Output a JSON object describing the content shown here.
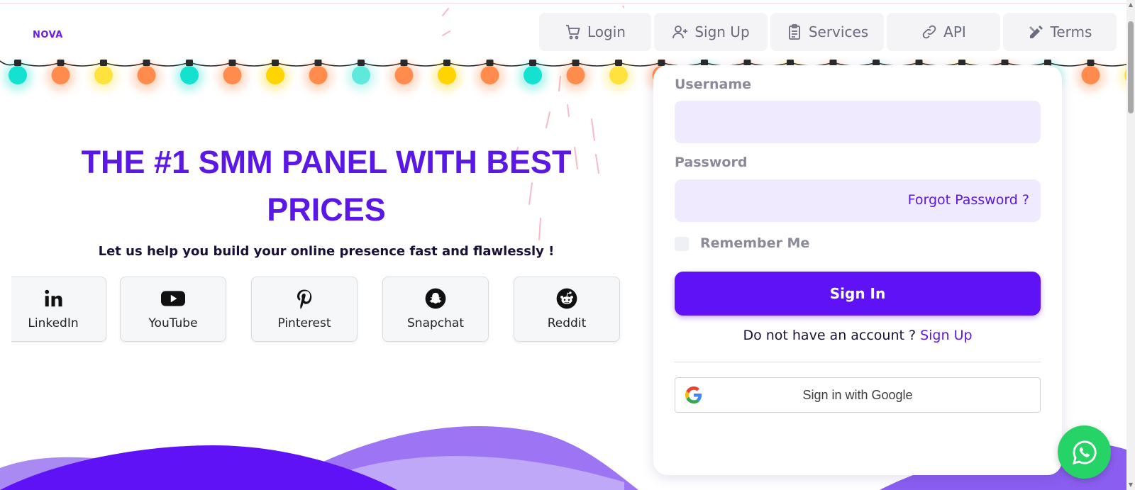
{
  "brand": {
    "logo": "NOVA"
  },
  "nav": [
    {
      "label": "Login",
      "icon": "cart-icon"
    },
    {
      "label": "Sign Up",
      "icon": "user-plus-icon"
    },
    {
      "label": "Services",
      "icon": "clipboard-icon"
    },
    {
      "label": "API",
      "icon": "link-icon"
    },
    {
      "label": "Terms",
      "icon": "pencil-ruler-icon"
    }
  ],
  "hero": {
    "title": "THE #1 SMM PANEL WITH BEST PRICES",
    "subtitle": "Let us help you build your online presence fast and flawlessly !"
  },
  "socials": [
    {
      "label": "LinkedIn",
      "icon": "linkedin-icon"
    },
    {
      "label": "YouTube",
      "icon": "youtube-icon"
    },
    {
      "label": "Pinterest",
      "icon": "pinterest-icon"
    },
    {
      "label": "Snapchat",
      "icon": "snapchat-icon"
    },
    {
      "label": "Reddit",
      "icon": "reddit-icon"
    }
  ],
  "login": {
    "username_label": "Username",
    "username_value": "",
    "password_label": "Password",
    "password_value": "",
    "forgot_label": "Forgot Password ?",
    "remember_label": "Remember Me",
    "remember_checked": false,
    "signin_label": "Sign In",
    "no_account_text": "Do not have an account ?",
    "signup_link": "Sign Up",
    "google_label": "Sign in with Google"
  },
  "colors": {
    "primary": "#5f12f5",
    "title": "#5b17e6",
    "field_bg": "#f0eafe",
    "whatsapp": "#25d366",
    "bulbs": [
      "#14e1cf",
      "#ff8c4d",
      "#ffe23d",
      "#ff8c4d",
      "#14e1cf",
      "#ff8c4d",
      "#ffd400",
      "#ff8c4d",
      "#5fe8dc",
      "#ff8c4d",
      "#ffd400",
      "#ff8c4d",
      "#14e1cf",
      "#ff8c4d",
      "#ffe23d",
      "#ff8c4d",
      "#14e1cf",
      "#ff8c4d",
      "#ffd400",
      "#ff8c4d",
      "#5fe8dc",
      "#ff8c4d",
      "#ffd400",
      "#ff8c4d",
      "#14e1cf",
      "#ff8c4d",
      "#ffe23d"
    ]
  },
  "floating": {
    "whatsapp_icon": "whatsapp-icon"
  }
}
